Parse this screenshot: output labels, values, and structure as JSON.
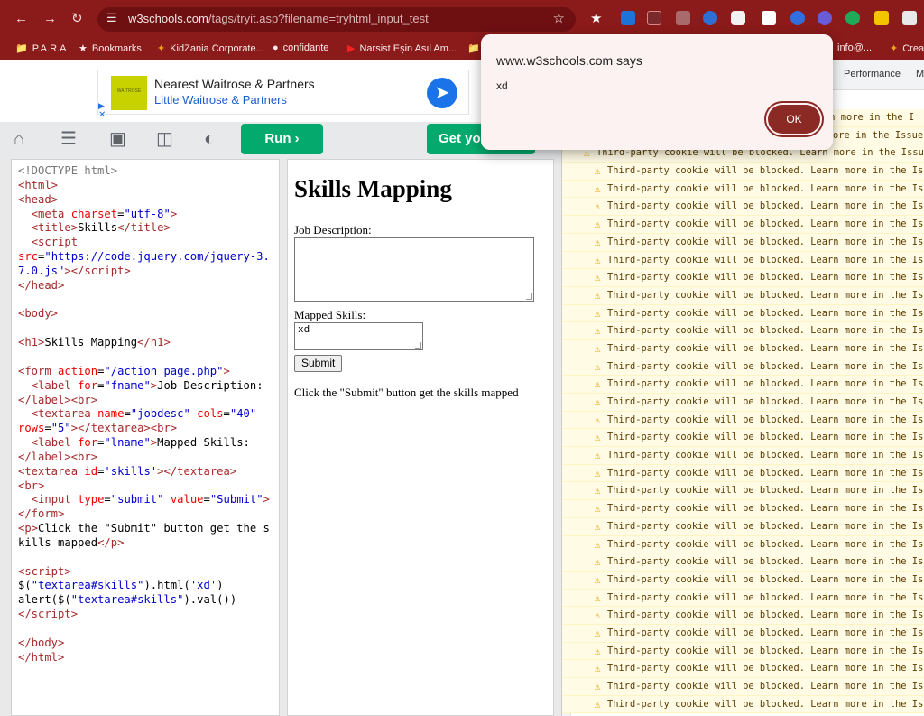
{
  "browser": {
    "url_host": "w3schools.com",
    "url_path": "/tags/tryit.asp?filename=tryhtml_input_test",
    "bookmarks": [
      "P.A.R.A",
      "Bookmarks",
      "KidZania Corporate...",
      "confidante",
      "Narsist Eşin Asıl Am...",
      "info@...",
      "Crea"
    ]
  },
  "ad": {
    "logo_text": "WAITROSE",
    "title": "Nearest Waitrose & Partners",
    "subtitle": "Little Waitrose & Partners"
  },
  "toolbar": {
    "run_label": "Run",
    "get_label": "Get you"
  },
  "code": {
    "l01": "<!DOCTYPE html>",
    "l02": "<html>",
    "l03": "<head>",
    "meta_tag": "meta",
    "meta_attr": "charset",
    "meta_val": "\"utf-8\"",
    "title_text": "Skills",
    "script_src": "\"https://code.jquery.com/jquery-3.7.0.js\"",
    "h1_text": "Skills Mapping",
    "form_action": "\"/action_page.php\"",
    "label1_for": "\"fname\"",
    "label1_text": "Job Description:",
    "ta_name": "\"jobdesc\"",
    "ta_cols": "\"40\"",
    "ta_rows": "\"5\"",
    "label2_for": "\"lname\"",
    "label2_text": "Mapped Skills:",
    "ta2_id": "'skills'",
    "input_type": "\"submit\"",
    "input_value": "\"Submit\"",
    "p_text": "Click the \"Submit\" button get the skills mapped",
    "js1_pre": "$(",
    "js1_sel": "\"textarea#skills\"",
    "js1_post": ").html(",
    "js1_arg": "'xd'",
    "js1_end": ")",
    "js2_pre": "alert($(",
    "js2_sel": "\"textarea#skills\"",
    "js2_post": ").val())"
  },
  "result": {
    "heading": "Skills Mapping",
    "label_job": "Job Description:",
    "label_mapped": "Mapped Skills:",
    "mapped_value": "xd",
    "submit_label": "Submit",
    "paragraph": "Click the \"Submit\" button get the skills mapped"
  },
  "devtools": {
    "tab_performance": "Performance",
    "tab_more": "M",
    "warning_text": "Third-party cookie will be blocked. Learn more in the Issues tab.",
    "first_warning_text": "Third-party cookie will be blocked. Learn more in the Issues tab.",
    "partial_1": "rn more in the I",
    "partial_2": "ore in the Issue"
  },
  "dialog": {
    "title": "www.w3schools.com says",
    "message": "xd",
    "ok_label": "OK"
  }
}
